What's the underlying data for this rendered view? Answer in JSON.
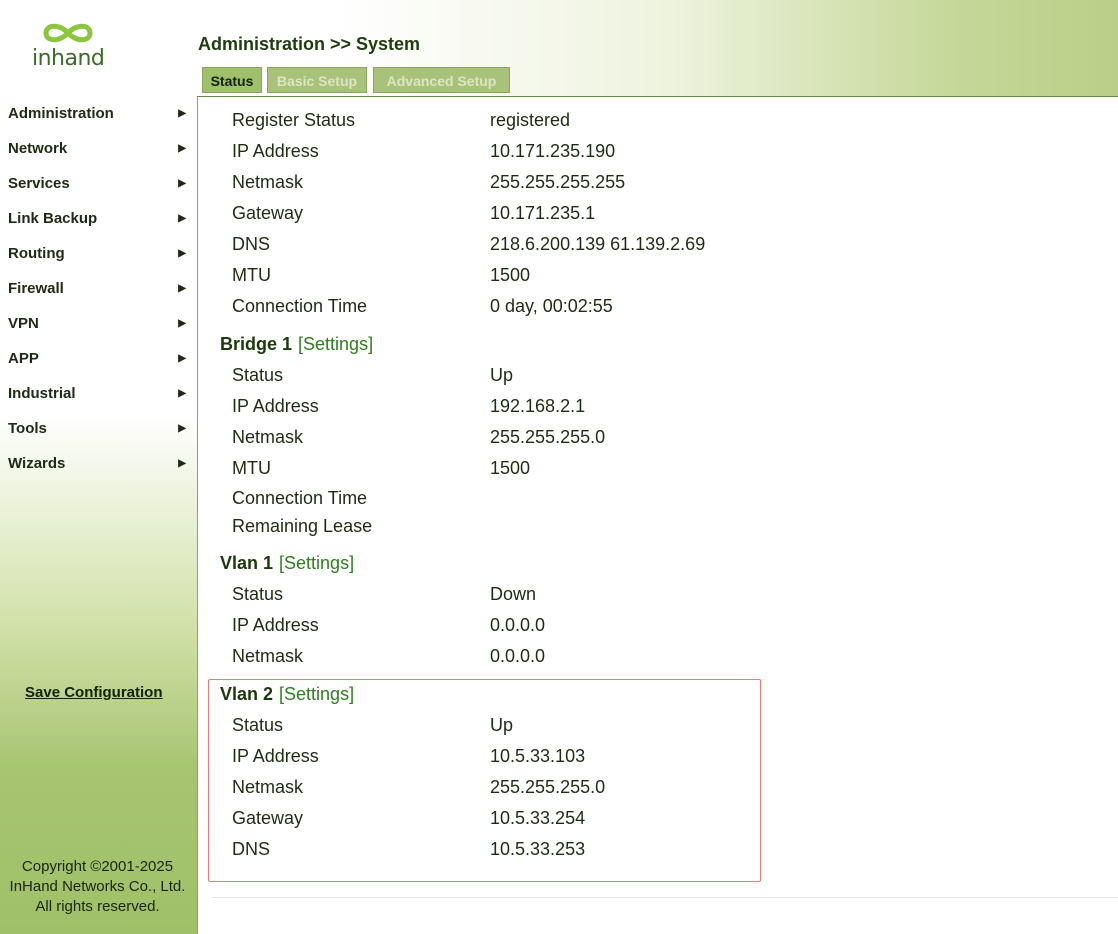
{
  "brand": {
    "logo_text": "inhand"
  },
  "header": {
    "title": "Administration >> System",
    "tabs": [
      {
        "label": "Status",
        "active": true
      },
      {
        "label": "Basic Setup",
        "active": false
      },
      {
        "label": "Advanced Setup",
        "active": false
      }
    ]
  },
  "sidebar": {
    "items": [
      {
        "label": "Administration"
      },
      {
        "label": "Network"
      },
      {
        "label": "Services"
      },
      {
        "label": "Link Backup"
      },
      {
        "label": "Routing"
      },
      {
        "label": "Firewall"
      },
      {
        "label": "VPN"
      },
      {
        "label": "APP"
      },
      {
        "label": "Industrial"
      },
      {
        "label": "Tools"
      },
      {
        "label": "Wizards"
      }
    ],
    "arrow": "▶",
    "save_label": "Save Configuration",
    "copyright": [
      "Copyright ©2001-2025",
      "InHand Networks Co., Ltd.",
      "All rights reserved."
    ]
  },
  "top_section": {
    "rows": [
      {
        "label": "Register Status",
        "value": "registered"
      },
      {
        "label": "IP Address",
        "value": "10.171.235.190"
      },
      {
        "label": "Netmask",
        "value": "255.255.255.255"
      },
      {
        "label": "Gateway",
        "value": "10.171.235.1"
      },
      {
        "label": "DNS",
        "value": "218.6.200.139 61.139.2.69"
      },
      {
        "label": "MTU",
        "value": "1500"
      },
      {
        "label": "Connection Time",
        "value": "0 day, 00:02:55"
      }
    ]
  },
  "bridge1": {
    "title": "Bridge 1",
    "settings": "[Settings]",
    "rows": [
      {
        "label": "Status",
        "value": "Up"
      },
      {
        "label": "IP Address",
        "value": "192.168.2.1"
      },
      {
        "label": "Netmask",
        "value": "255.255.255.0"
      },
      {
        "label": "MTU",
        "value": "1500"
      },
      {
        "label": "Connection Time",
        "value": ""
      },
      {
        "label": "Remaining Lease",
        "value": ""
      }
    ]
  },
  "vlan1": {
    "title": "Vlan 1",
    "settings": "[Settings]",
    "rows": [
      {
        "label": "Status",
        "value": "Down"
      },
      {
        "label": "IP Address",
        "value": "0.0.0.0"
      },
      {
        "label": "Netmask",
        "value": "0.0.0.0"
      }
    ]
  },
  "vlan2": {
    "title": "Vlan 2",
    "settings": "[Settings]",
    "rows": [
      {
        "label": "Status",
        "value": "Up"
      },
      {
        "label": "IP Address",
        "value": "10.5.33.103"
      },
      {
        "label": "Netmask",
        "value": "255.255.255.0"
      },
      {
        "label": "Gateway",
        "value": "10.5.33.254"
      },
      {
        "label": "DNS",
        "value": "10.5.33.253"
      }
    ]
  },
  "colors": {
    "accent_green": "#9fc06a",
    "link_green": "#2f7d1f",
    "highlight_red": "#e8787a"
  }
}
